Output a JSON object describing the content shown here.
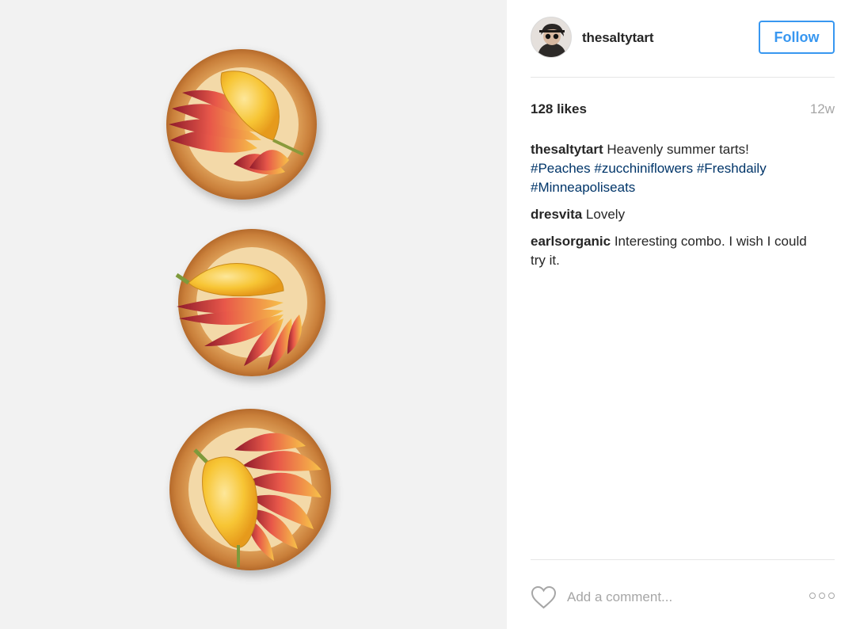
{
  "post": {
    "photo": {
      "subject": "three peach tarts with zucchini flowers"
    },
    "header": {
      "username": "thesaltytart",
      "follow_label": "Follow",
      "accent_color": "#3897f0"
    },
    "stats": {
      "likes": "128 likes",
      "time_ago": "12w"
    },
    "caption": {
      "user": "thesaltytart",
      "text": " Heavenly summer tarts!",
      "hashtags": [
        "#Peaches",
        "#zucchiniflowers",
        "#Freshdaily",
        "#Minneapoliseats"
      ]
    },
    "comments": [
      {
        "user": "dresvita",
        "text": " Lovely"
      },
      {
        "user": "earlsorganic",
        "text": " Interesting combo. I wish I could try it."
      }
    ],
    "footer": {
      "comment_placeholder": "Add a comment...",
      "like_icon": "heart-outline-icon",
      "more_icon": "more-options-icon"
    }
  }
}
